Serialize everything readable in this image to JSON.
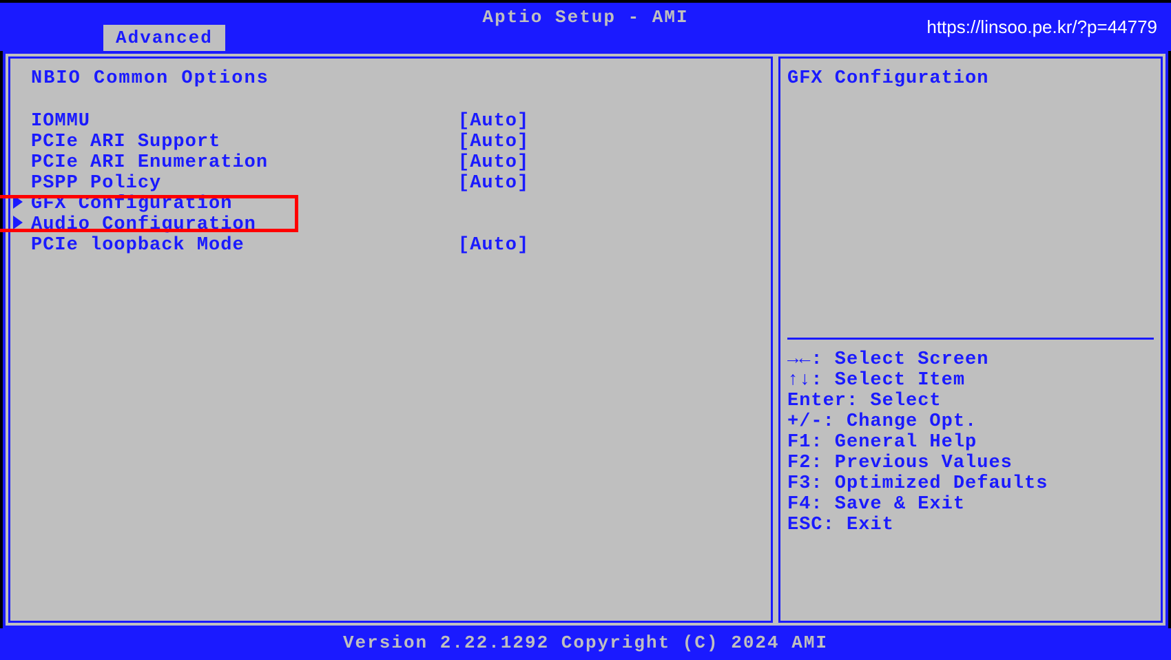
{
  "header": {
    "title": "Aptio Setup - AMI",
    "url": "https://linsoo.pe.kr/?p=44779",
    "tab": "Advanced"
  },
  "left_panel": {
    "section_title": "NBIO Common Options",
    "items": [
      {
        "label": "IOMMU",
        "value": "[Auto]",
        "submenu": false
      },
      {
        "label": "PCIe ARI Support",
        "value": "[Auto]",
        "submenu": false
      },
      {
        "label": "PCIe ARI Enumeration",
        "value": "[Auto]",
        "submenu": false
      },
      {
        "label": "PSPP Policy",
        "value": "[Auto]",
        "submenu": false
      },
      {
        "label": "GFX Configuration",
        "value": "",
        "submenu": true,
        "highlighted": true
      },
      {
        "label": "Audio Configuration",
        "value": "",
        "submenu": true
      },
      {
        "label": "PCIe loopback Mode",
        "value": "[Auto]",
        "submenu": false
      }
    ]
  },
  "right_panel": {
    "help_title": "GFX Configuration",
    "keys": [
      "→←: Select Screen",
      "↑↓: Select Item",
      "Enter: Select",
      "+/-: Change Opt.",
      "F1: General Help",
      "F2: Previous Values",
      "F3: Optimized Defaults",
      "F4: Save & Exit",
      "ESC: Exit"
    ]
  },
  "footer": {
    "text": "Version 2.22.1292 Copyright (C) 2024 AMI"
  }
}
